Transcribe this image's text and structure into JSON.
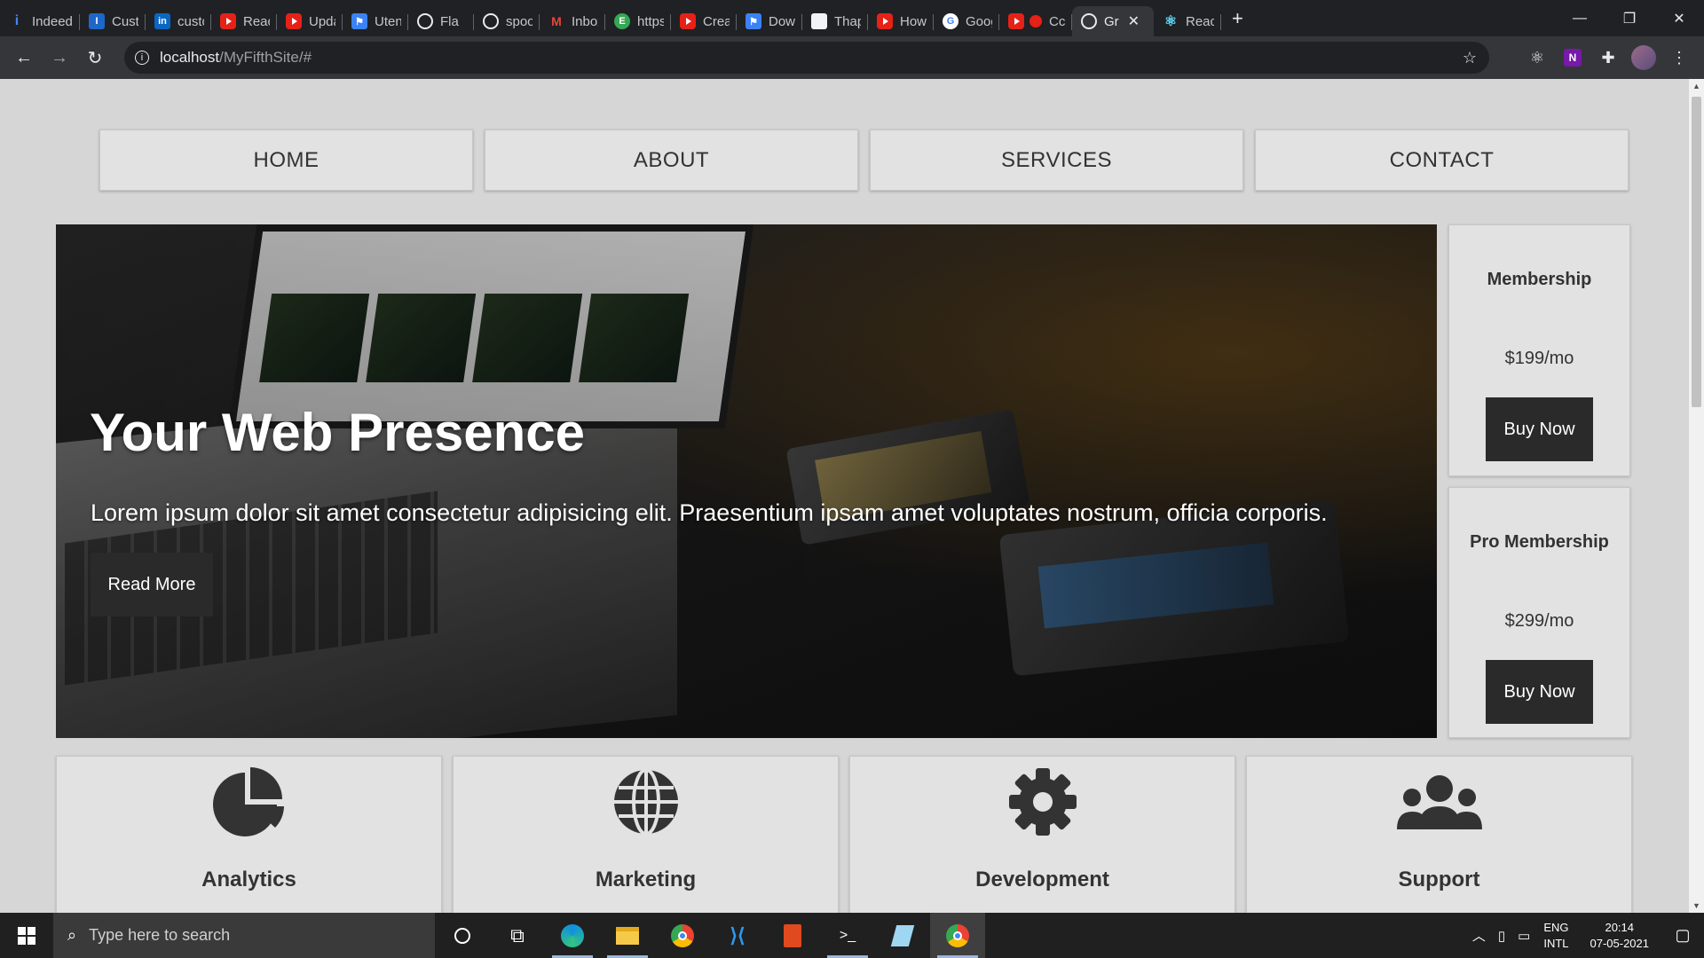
{
  "browser": {
    "tabs": [
      {
        "label": "Indeed",
        "icon": "indeed-icon"
      },
      {
        "label": "Custom",
        "icon": "docs-icon"
      },
      {
        "label": "custom",
        "icon": "linkedin-icon"
      },
      {
        "label": "React",
        "icon": "youtube-icon"
      },
      {
        "label": "Updat",
        "icon": "youtube-icon"
      },
      {
        "label": "Utensi",
        "icon": "flag-icon"
      },
      {
        "label": "Fla",
        "icon": "globe-icon"
      },
      {
        "label": "spoon",
        "icon": "globe-icon"
      },
      {
        "label": "Inbox",
        "icon": "gmail-icon"
      },
      {
        "label": "https",
        "icon": "e-icon"
      },
      {
        "label": "Create",
        "icon": "youtube-icon"
      },
      {
        "label": "Down",
        "icon": "flag-icon"
      },
      {
        "label": "Thapa",
        "icon": "doc-icon"
      },
      {
        "label": "How t",
        "icon": "youtube-icon"
      },
      {
        "label": "Googl",
        "icon": "google-icon"
      },
      {
        "label": "Cc",
        "icon": "youtube-icon"
      },
      {
        "label": "Gr",
        "icon": "globe-icon",
        "active": true
      },
      {
        "label": "React",
        "icon": "react-icon"
      }
    ],
    "new_tab": "+",
    "url_host": "localhost",
    "url_path": "/MyFifthSite/#"
  },
  "page": {
    "nav": [
      "HOME",
      "ABOUT",
      "SERVICES",
      "CONTACT"
    ],
    "hero": {
      "title": "Your Web Presence",
      "text": "Lorem ipsum dolor sit amet consectetur adipisicing elit. Praesentium ipsam amet voluptates nostrum, officia corporis.",
      "button": "Read More"
    },
    "pricing": [
      {
        "title": "Membership",
        "price": "$199/mo",
        "button": "Buy Now"
      },
      {
        "title": "Pro Membership",
        "price": "$299/mo",
        "button": "Buy Now"
      }
    ],
    "features": [
      {
        "label": "Analytics",
        "icon": "chart-pie-icon"
      },
      {
        "label": "Marketing",
        "icon": "globe-icon"
      },
      {
        "label": "Development",
        "icon": "cog-icon"
      },
      {
        "label": "Support",
        "icon": "users-icon"
      }
    ]
  },
  "taskbar": {
    "search_placeholder": "Type here to search",
    "lang_top": "ENG",
    "lang_bottom": "INTL",
    "time": "20:14",
    "date": "07-05-2021"
  },
  "colors": {
    "page_bg": "#d6d6d6",
    "card_bg": "#e2e2e2",
    "dark_button": "#2a2a2a",
    "chrome_dark": "#202124"
  }
}
